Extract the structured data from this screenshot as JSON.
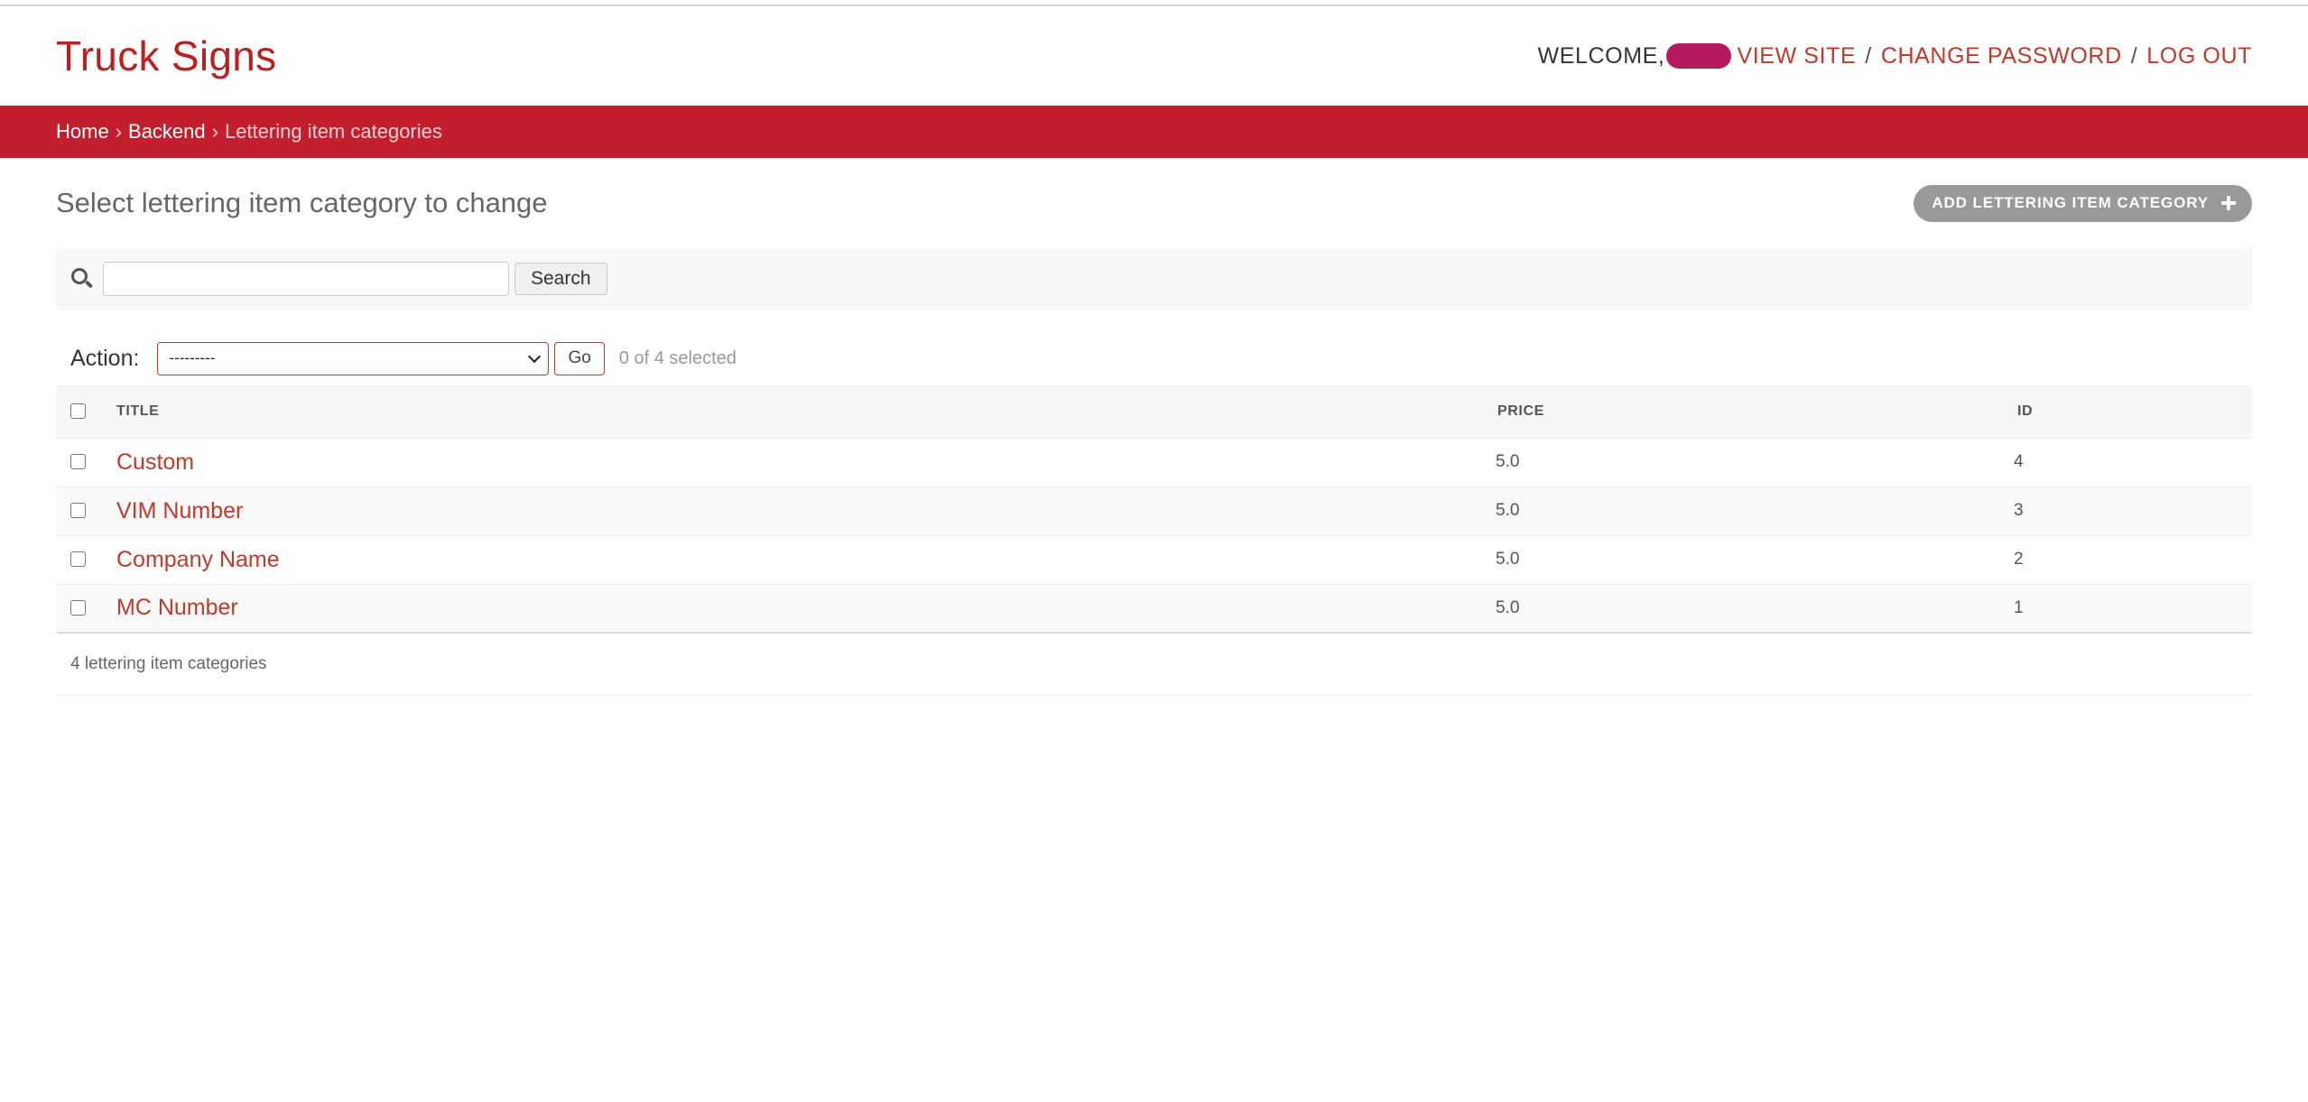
{
  "header": {
    "brand": "Truck Signs",
    "welcome": "WELCOME,",
    "view_site": "VIEW SITE",
    "change_password": "CHANGE PASSWORD",
    "log_out": "LOG OUT",
    "separator": "/"
  },
  "breadcrumbs": {
    "home": "Home",
    "backend": "Backend",
    "current": "Lettering item categories",
    "arrow": "›"
  },
  "page": {
    "title": "Select lettering item category to change",
    "add_button": "ADD LETTERING ITEM CATEGORY"
  },
  "search": {
    "value": "",
    "button": "Search"
  },
  "actions": {
    "label": "Action:",
    "selected_option": "---------",
    "go": "Go",
    "counter": "0 of 4 selected"
  },
  "table": {
    "headers": {
      "title": "TITLE",
      "price": "PRICE",
      "id": "ID"
    },
    "rows": [
      {
        "title": "Custom",
        "price": "5.0",
        "id": "4"
      },
      {
        "title": "VIM Number",
        "price": "5.0",
        "id": "3"
      },
      {
        "title": "Company Name",
        "price": "5.0",
        "id": "2"
      },
      {
        "title": "MC Number",
        "price": "5.0",
        "id": "1"
      }
    ]
  },
  "paginator": "4 lettering item categories",
  "colors": {
    "brand_red": "#ba2121",
    "breadcrumb_bar": "#c21e2e",
    "link": "#c0392b",
    "add_button_bg": "#999999",
    "redacted_user": "#b5195e"
  }
}
